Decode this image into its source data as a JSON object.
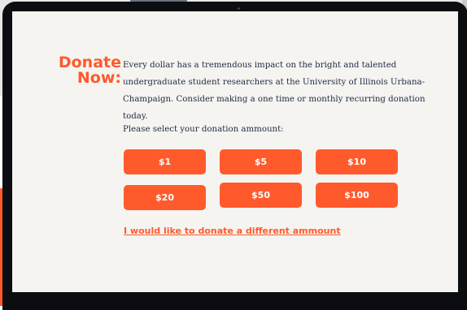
{
  "donate": {
    "heading_line1": "Donate",
    "heading_line2": "Now:",
    "intro": "Every dollar has a tremendous impact on the bright and talented undergraduate student researchers at the University of Illinois Urbana-Champaign. Consider making a one time or monthly recurring donation today.",
    "select_label": "Please select your donation ammount:",
    "amounts": [
      "$1",
      "$5",
      "$10",
      "$20",
      "$50",
      "$100"
    ],
    "different_link": "I would like to donate a different ammount"
  },
  "colors": {
    "accent": "#ff5a2c",
    "text": "#1f2a44",
    "screen_background": "#f6f4f0",
    "bezel": "#0c0d10"
  }
}
